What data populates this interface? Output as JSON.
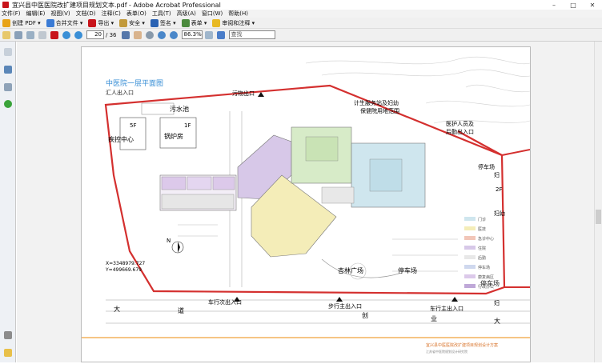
{
  "window": {
    "title": "宜兴县中医医院改扩建项目规划文本.pdf - Adobe Acrobat Professional"
  },
  "window_controls": {
    "minimize": "–",
    "maximize": "□",
    "close": "✕"
  },
  "menu": {
    "items": [
      "文件(F)",
      "编辑(E)",
      "视图(V)",
      "文档(D)",
      "注释(C)",
      "表单(O)",
      "工具(T)",
      "高级(A)",
      "窗口(W)",
      "帮助(H)"
    ]
  },
  "toolbar1": {
    "items": [
      {
        "label": "创建 PDF ▾",
        "icon": "create-pdf-icon",
        "color": "#e8a317"
      },
      {
        "label": "合并文件 ▾",
        "icon": "combine-files-icon",
        "color": "#3a7bd5"
      },
      {
        "label": "导出 ▾",
        "icon": "export-icon",
        "color": "#c8141b"
      },
      {
        "label": "安全 ▾",
        "icon": "lock-icon",
        "color": "#c29a3b"
      },
      {
        "label": "签名 ▾",
        "icon": "pen-icon",
        "color": "#2a62b3"
      },
      {
        "label": "表单 ▾",
        "icon": "form-icon",
        "color": "#4a8a3c"
      },
      {
        "label": "审阅和注释 ▾",
        "icon": "review-icon",
        "color": "#e8b923"
      }
    ]
  },
  "toolbar2": {
    "page_current": "20",
    "page_total": "/ 36",
    "zoom": "86.3%",
    "find_placeholder": "查找"
  },
  "left_nav": {
    "icons": [
      "pages-icon",
      "bookmarks-icon",
      "signatures-icon",
      "attachments-icon",
      "paperclip-icon",
      "comments-icon"
    ]
  },
  "plan": {
    "title": "中医院一层平面图",
    "labels": {
      "huizhan": "汇人出入口",
      "wushui": "污水池",
      "wuwu": "污物出口",
      "guolu": "锅炉房",
      "jikong": "疾控中心",
      "f5": "5F",
      "f1": "1F",
      "weisheng1": "计生服务站及妇幼",
      "weisheng2": "保健院用地范围",
      "yihu1": "医护人员及",
      "yihu2": "后勤出入口",
      "tingche1": "停车场",
      "tingche2": "停车场",
      "tingche3": "停车场",
      "guangchang": "杏林广场",
      "chexing": "车行次出入口",
      "buxing": "步行主出入口",
      "chexing2": "车行主出入口",
      "da": "大",
      "dao": "道",
      "chuang": "创",
      "ye": "业",
      "da2": "大",
      "fu": "妇",
      "fu2": "妇幼",
      "fu3": "妇",
      "coord1": "X=3348979.727",
      "coord2": "Y=499669.679",
      "f2r": "2F",
      "north": "N"
    },
    "legend": [
      "门诊",
      "医技",
      "急诊中心",
      "住院",
      "后勤",
      "停车场",
      "康复病区",
      "行政办公",
      "停车场"
    ],
    "footer1": "宜兴县中医医院改扩建项目规划设计方案",
    "footer2": "江苏省中医院规划设计研究院"
  }
}
